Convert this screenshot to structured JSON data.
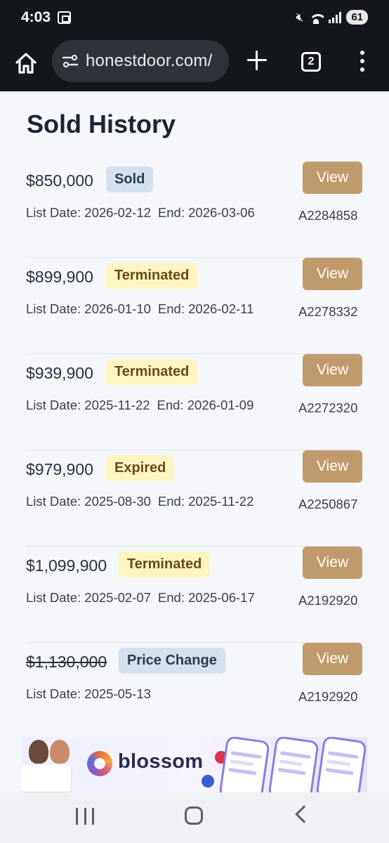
{
  "status_bar": {
    "time": "4:03",
    "battery": "61",
    "icons": [
      "screencast-icon",
      "mute-icon",
      "wifi-icon",
      "signal-icon",
      "battery-icon"
    ]
  },
  "browser": {
    "url": "honestdoor.com/",
    "tab_count": "2",
    "icons": [
      "home-icon",
      "site-settings-icon",
      "new-tab-icon",
      "tab-switcher-icon",
      "more-menu-icon"
    ]
  },
  "page": {
    "title": "Sold History",
    "listings": [
      {
        "price": "$850,000",
        "status": "Sold",
        "list_date": "List Date: 2026-02-12",
        "end_date": "End: 2026-03-06",
        "view_label": "View",
        "id": "A2284858",
        "struck": false
      },
      {
        "price": "$899,900",
        "status": "Terminated",
        "list_date": "List Date: 2026-01-10",
        "end_date": "End: 2026-02-11",
        "view_label": "View",
        "id": "A2278332",
        "struck": false
      },
      {
        "price": "$939,900",
        "status": "Terminated",
        "list_date": "List Date: 2025-11-22",
        "end_date": "End: 2026-01-09",
        "view_label": "View",
        "id": "A2272320",
        "struck": false
      },
      {
        "price": "$979,900",
        "status": "Expired",
        "list_date": "List Date: 2025-08-30",
        "end_date": "End: 2025-11-22",
        "view_label": "View",
        "id": "A2250867",
        "struck": false
      },
      {
        "price": "$1,099,900",
        "status": "Terminated",
        "list_date": "List Date: 2025-02-07",
        "end_date": "End: 2025-06-17",
        "view_label": "View",
        "id": "A2192920",
        "struck": false
      },
      {
        "price": "$1,130,000",
        "status": "Price Change",
        "list_date": "List Date: 2025-05-13",
        "end_date": "",
        "view_label": "View",
        "id": "A2192920",
        "struck": true
      }
    ]
  },
  "ad": {
    "brand": "blossom"
  },
  "colors": {
    "view_button": "#c09a6b",
    "badge_blue": "#d3e1ed",
    "badge_yellow": "#fdf6c3",
    "browser_chrome": "#14171c"
  }
}
